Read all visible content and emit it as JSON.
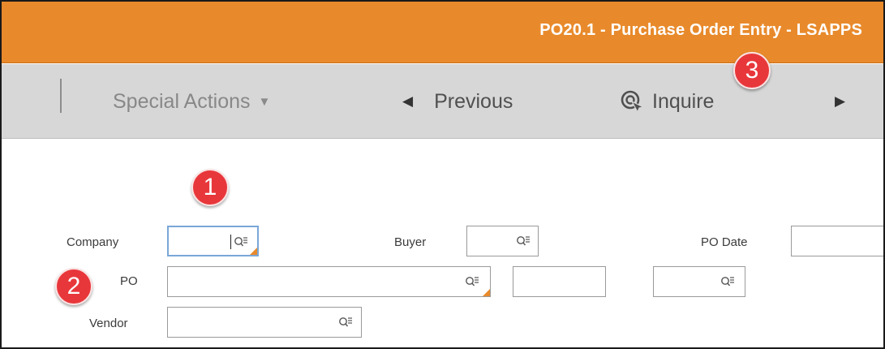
{
  "window": {
    "title": "PO20.1 - Purchase Order Entry - LSAPPS"
  },
  "toolbar": {
    "special_actions": "Special Actions",
    "previous": "Previous",
    "inquire": "Inquire"
  },
  "form": {
    "company_label": "Company",
    "buyer_label": "Buyer",
    "po_date_label": "PO Date",
    "po_label": "PO",
    "vendor_label": "Vendor"
  },
  "callouts": [
    "1",
    "2",
    "3"
  ],
  "colors": {
    "accent": "#e88a2c",
    "badge": "#e8373b",
    "toolbar": "#d7d7d7"
  }
}
